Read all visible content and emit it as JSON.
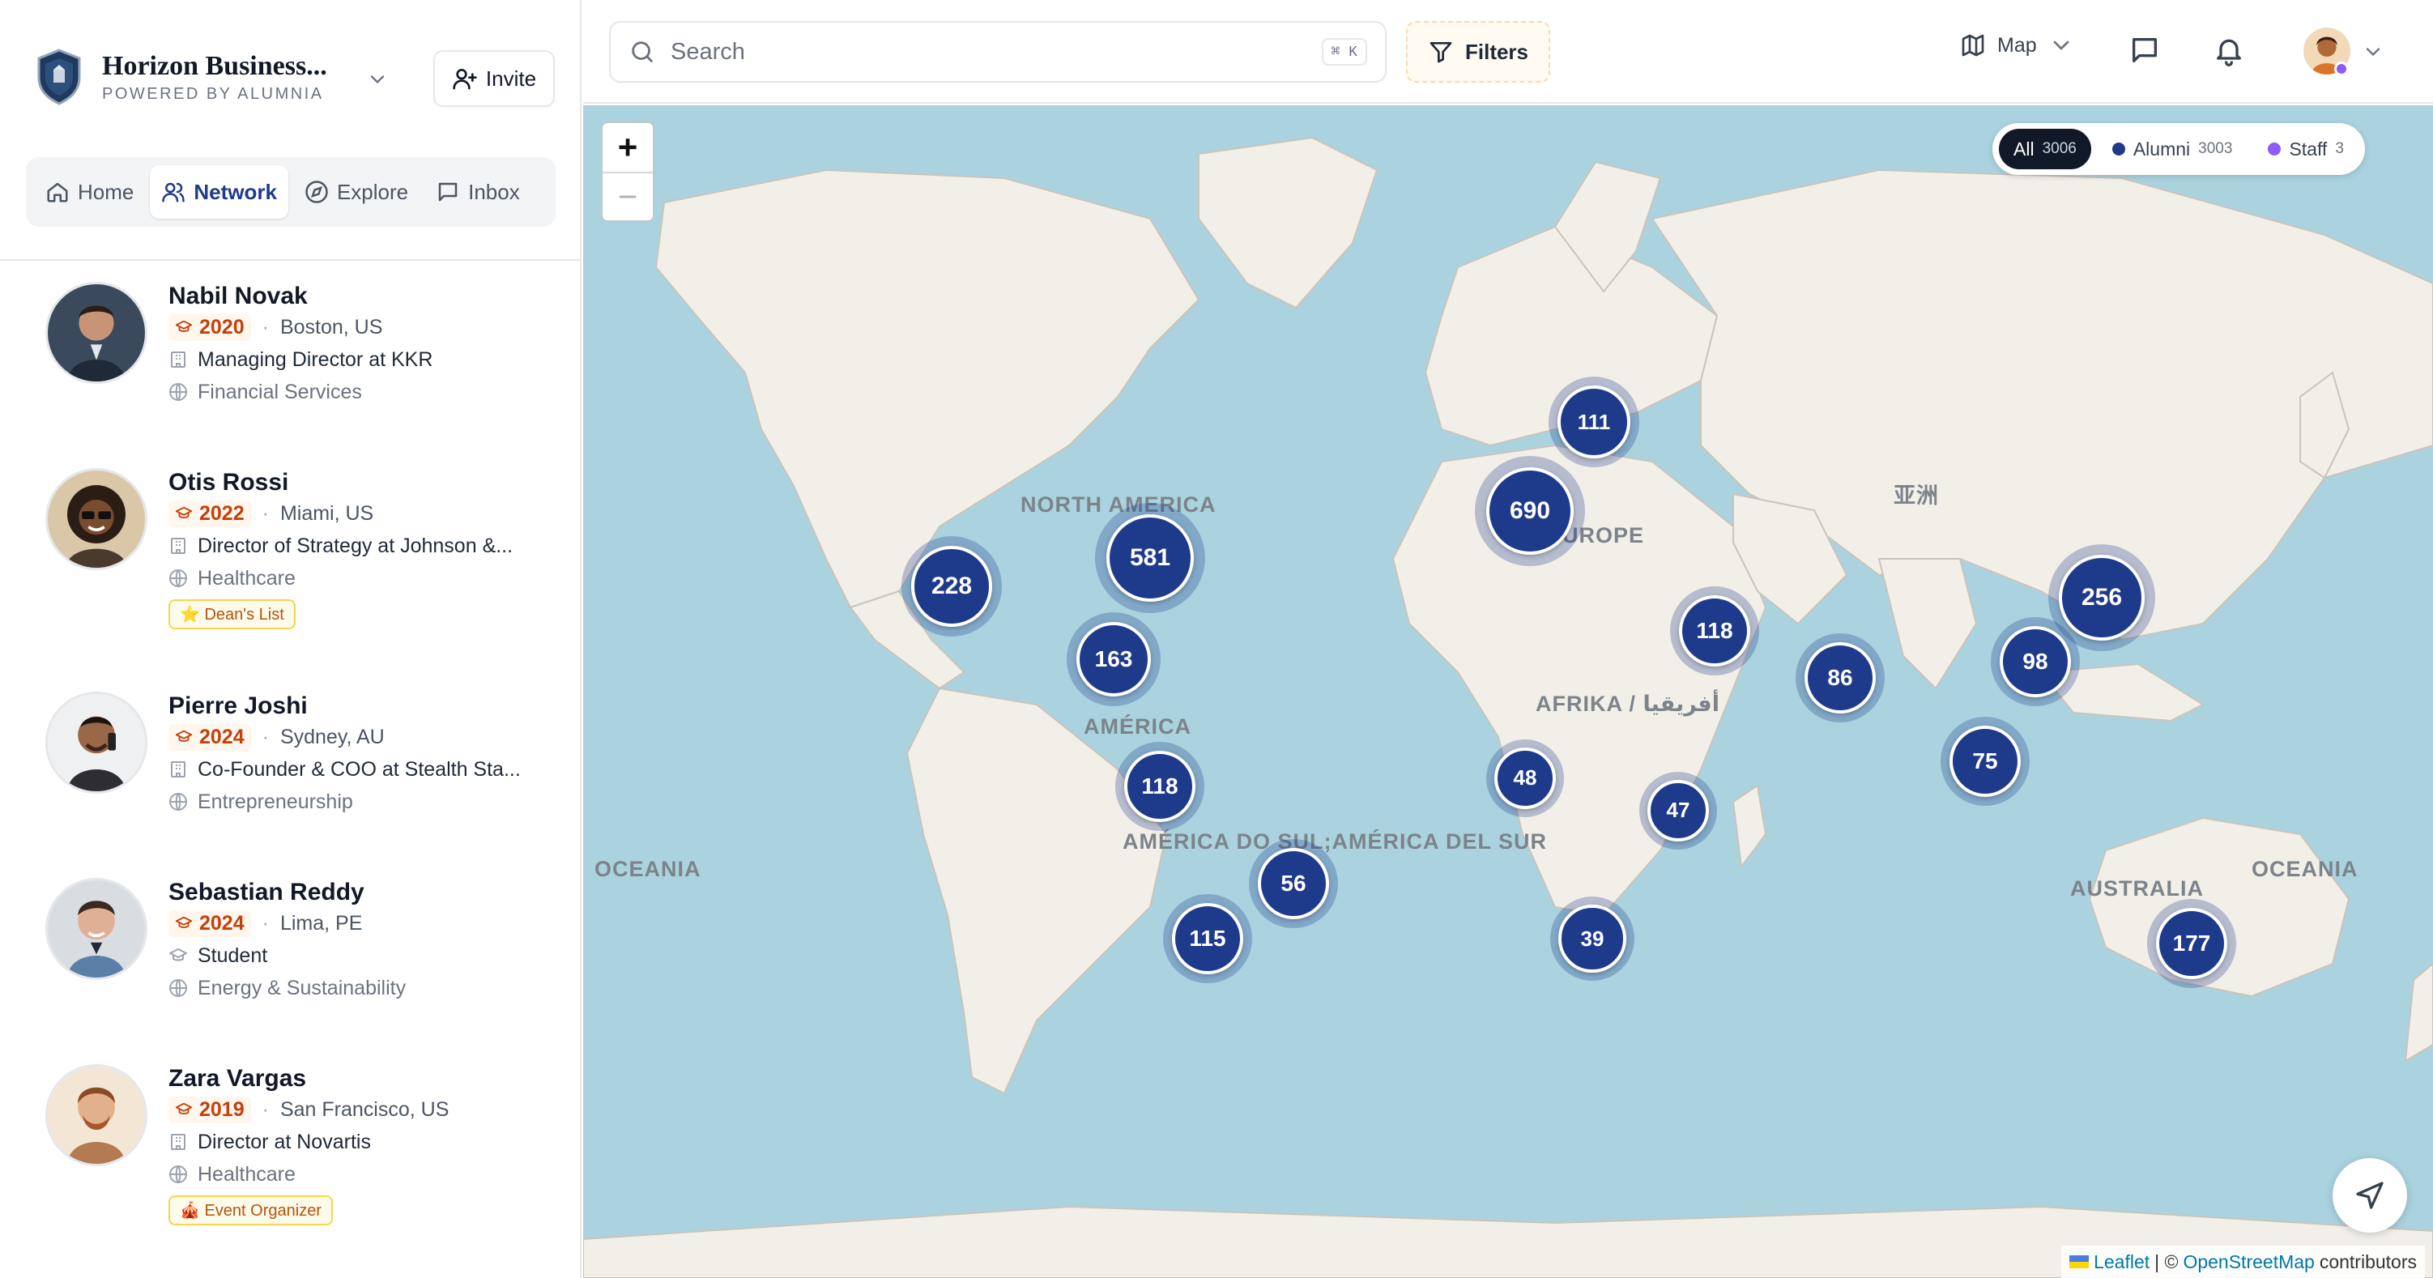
{
  "brand": {
    "title": "Horizon Business...",
    "subtitle": "POWERED BY ALUMNIA"
  },
  "invite_label": "Invite",
  "tabs": [
    {
      "label": "Home",
      "icon": "home-icon"
    },
    {
      "label": "Network",
      "icon": "users-icon",
      "active": true
    },
    {
      "label": "Explore",
      "icon": "compass-icon"
    },
    {
      "label": "Inbox",
      "icon": "message-icon"
    }
  ],
  "people": [
    {
      "name": "Nabil Novak",
      "year": "2020",
      "location": "Boston, US",
      "role": "Managing Director at KKR",
      "industry": "Financial Services",
      "tag": ""
    },
    {
      "name": "Otis Rossi",
      "year": "2022",
      "location": "Miami, US",
      "role": "Director of Strategy at Johnson &...",
      "industry": "Healthcare",
      "tag": "⭐ Dean's List"
    },
    {
      "name": "Pierre Joshi",
      "year": "2024",
      "location": "Sydney, AU",
      "role": "Co-Founder & COO at Stealth Sta...",
      "industry": "Entrepreneurship",
      "tag": ""
    },
    {
      "name": "Sebastian Reddy",
      "year": "2024",
      "location": "Lima, PE",
      "role": "Student",
      "industry": "Energy & Sustainability",
      "tag": ""
    },
    {
      "name": "Zara Vargas",
      "year": "2019",
      "location": "San Francisco, US",
      "role": "Director at Novartis",
      "industry": "Healthcare",
      "tag": "🎪 Event Organizer"
    }
  ],
  "search": {
    "placeholder": "Search",
    "shortcut": "⌘ K"
  },
  "filters_label": "Filters",
  "view_mode": "Map",
  "legend": {
    "all": {
      "label": "All",
      "count": "3006"
    },
    "alumni": {
      "label": "Alumni",
      "count": "3003",
      "color": "#1e3a8a"
    },
    "staff": {
      "label": "Staff",
      "count": "3",
      "color": "#8b5cf6"
    }
  },
  "map": {
    "labels": {
      "north_america": "NORTH AMERICA",
      "europe": "EUROPE",
      "asia": "亚洲",
      "africa": "AFRIKA / أفريقيا",
      "america": "AMÉRICA",
      "south_america": "AMÉRICA DO SUL;AMÉRICA DEL SUR",
      "oceania_left": "OCEANIA",
      "oceania_right": "OCEANIA",
      "australia": "AUSTRALIA"
    },
    "clusters": [
      {
        "count": "111",
        "region": "scandinavia"
      },
      {
        "count": "690",
        "region": "western-europe"
      },
      {
        "count": "581",
        "region": "eastern-us"
      },
      {
        "count": "228",
        "region": "western-us"
      },
      {
        "count": "163",
        "region": "mexico"
      },
      {
        "count": "118",
        "region": "middle-east"
      },
      {
        "count": "86",
        "region": "india"
      },
      {
        "count": "256",
        "region": "east-asia"
      },
      {
        "count": "98",
        "region": "southeast-asia"
      },
      {
        "count": "75",
        "region": "singapore"
      },
      {
        "count": "48",
        "region": "west-africa"
      },
      {
        "count": "47",
        "region": "east-africa"
      },
      {
        "count": "118",
        "region": "northern-south-america"
      },
      {
        "count": "56",
        "region": "brazil"
      },
      {
        "count": "115",
        "region": "southern-cone"
      },
      {
        "count": "39",
        "region": "south-africa"
      },
      {
        "count": "177",
        "region": "australia"
      }
    ]
  },
  "attribution": {
    "leaflet": "Leaflet",
    "sep": "| ©",
    "osm": "OpenStreetMap",
    "tail": "contributors"
  }
}
